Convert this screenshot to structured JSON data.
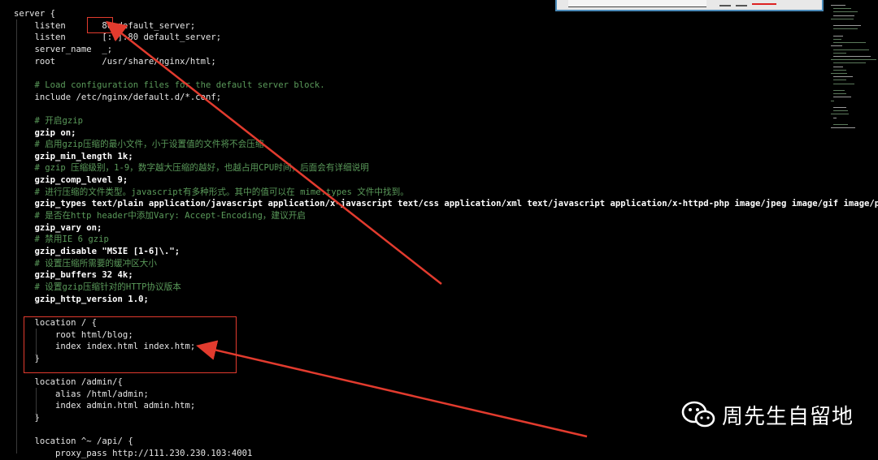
{
  "code_lines": [
    {
      "text": "server {",
      "kind": "normal"
    },
    {
      "text": "    listen       80 default_server;",
      "kind": "normal"
    },
    {
      "text": "    listen       [::]:80 default_server;",
      "kind": "normal"
    },
    {
      "text": "    server_name  _;",
      "kind": "normal"
    },
    {
      "text": "    root         /usr/share/nginx/html;",
      "kind": "normal"
    },
    {
      "text": "",
      "kind": "normal"
    },
    {
      "text": "    # Load configuration files for the default server block.",
      "kind": "comment"
    },
    {
      "text": "    include /etc/nginx/default.d/*.conf;",
      "kind": "normal"
    },
    {
      "text": "",
      "kind": "normal"
    },
    {
      "text": "    # 开启gzip",
      "kind": "comment"
    },
    {
      "text": "    gzip on;",
      "kind": "bold"
    },
    {
      "text": "    # 启用gzip压缩的最小文件，小于设置值的文件将不会压缩",
      "kind": "comment"
    },
    {
      "text": "    gzip_min_length 1k;",
      "kind": "bold"
    },
    {
      "text": "    # gzip 压缩级别，1-9，数字越大压缩的越好，也越占用CPU时间，后面会有详细说明",
      "kind": "comment"
    },
    {
      "text": "    gzip_comp_level 9;",
      "kind": "bold"
    },
    {
      "text": "    # 进行压缩的文件类型。javascript有多种形式。其中的值可以在 mime.types 文件中找到。",
      "kind": "comment"
    },
    {
      "text": "    gzip_types text/plain application/javascript application/x-javascript text/css application/xml text/javascript application/x-httpd-php image/jpeg image/gif image/png",
      "kind": "bold"
    },
    {
      "text": "    # 是否在http header中添加Vary: Accept-Encoding，建议开启",
      "kind": "comment"
    },
    {
      "text": "    gzip_vary on;",
      "kind": "bold"
    },
    {
      "text": "    # 禁用IE 6 gzip",
      "kind": "comment"
    },
    {
      "text": "    gzip_disable \"MSIE [1-6]\\.\";",
      "kind": "bold"
    },
    {
      "text": "    # 设置压缩所需要的缓冲区大小",
      "kind": "comment"
    },
    {
      "text": "    gzip_buffers 32 4k;",
      "kind": "bold"
    },
    {
      "text": "    # 设置gzip压缩针对的HTTP协议版本",
      "kind": "comment"
    },
    {
      "text": "    gzip_http_version 1.0;",
      "kind": "bold"
    },
    {
      "text": "",
      "kind": "normal"
    },
    {
      "text": "    location / {",
      "kind": "normal"
    },
    {
      "text": "        root html/blog;",
      "kind": "normal"
    },
    {
      "text": "        index index.html index.htm;",
      "kind": "normal"
    },
    {
      "text": "    }",
      "kind": "normal"
    },
    {
      "text": "",
      "kind": "normal"
    },
    {
      "text": "    location /admin/{",
      "kind": "normal"
    },
    {
      "text": "        alias /html/admin;",
      "kind": "normal"
    },
    {
      "text": "        index admin.html admin.htm;",
      "kind": "normal"
    },
    {
      "text": "    }",
      "kind": "normal"
    },
    {
      "text": "",
      "kind": "normal"
    },
    {
      "text": "    location ^~ /api/ {",
      "kind": "normal"
    },
    {
      "text": "        proxy_pass http://111.230.230.103:4001",
      "kind": "normal"
    }
  ],
  "watermark": {
    "icon": "wechat-icon",
    "text": "周先生自留地"
  },
  "colors": {
    "background": "#000000",
    "text": "#e6e6e6",
    "comment": "#5a9a5a",
    "annotation_red": "#e23b2e"
  },
  "search_bar": {
    "icon": "search-icon"
  }
}
